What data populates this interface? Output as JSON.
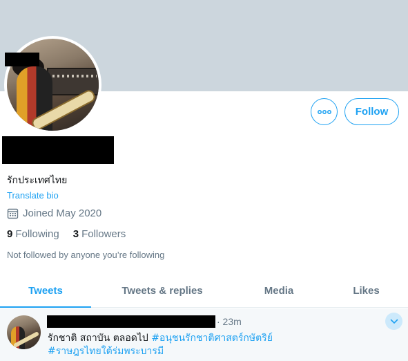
{
  "profile": {
    "bio": "รักประเทศไทย",
    "translate_bio": "Translate bio",
    "joined": "Joined May 2020",
    "following_count": "9",
    "following_label": "Following",
    "followers_count": "3",
    "followers_label": "Followers",
    "not_followed": "Not followed by anyone you’re following",
    "follow_button": "Follow",
    "more_icon": "more-horizontal-icon",
    "calendar_icon": "calendar-icon"
  },
  "tabs": [
    {
      "label": "Tweets",
      "active": true
    },
    {
      "label": "Tweets & replies",
      "active": false
    },
    {
      "label": "Media",
      "active": false
    },
    {
      "label": "Likes",
      "active": false
    }
  ],
  "tweet": {
    "time": "· 23m",
    "text_plain": "รักชาติ สถาบัน ตลอดไป ",
    "hashtag1": "#อนุชนรักชาติศาสตร์กษัตริย์",
    "hashtag2": "#ราษฎรไทยใต้ร่มพระบารมี",
    "chevron_icon": "chevron-down-icon"
  },
  "colors": {
    "accent": "#1da1f2",
    "banner": "#ccd6dd",
    "muted": "#657786",
    "text": "#14171a"
  }
}
